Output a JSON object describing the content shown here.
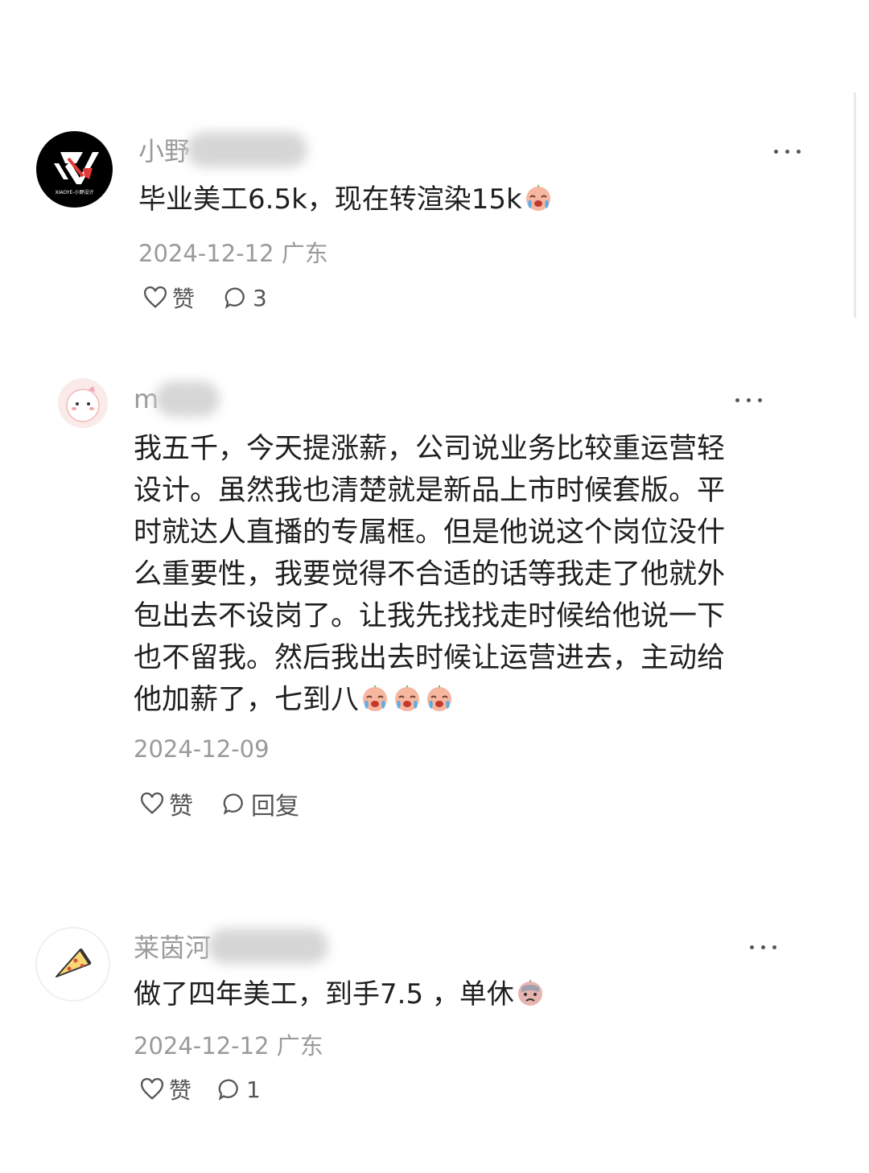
{
  "comments": [
    {
      "username": "小野",
      "text": "毕业美工6.5k，现在转渲染15k",
      "emoji": "crying-face-emoji",
      "date": "2024-12-12 广东",
      "like_label": "赞",
      "reply_count": "3"
    },
    {
      "username": "m",
      "text_lines": [
        "我五千，今天提涨薪，公司说业务比较重运营轻",
        "设计。虽然我也清楚就是新品上市时候套版。平",
        "时就达人直播的专属框。但是他说这个岗位没什",
        "么重要性，我要觉得不合适的话等我走了他就外",
        "包出去不设岗了。让我先找找走时候给他说一下",
        "也不留我。然后我出去时候让运营进去，主动给",
        "他加薪了，七到八"
      ],
      "emoji": "crying-face-emoji",
      "date": "2024-12-09",
      "like_label": "赞",
      "reply_label": "回复"
    },
    {
      "username": "莱茵河",
      "text": "做了四年美工，到手7.5 ，单休",
      "emoji": "sad-face-emoji",
      "date": "2024-12-12 广东",
      "like_label": "赞",
      "reply_count": "1"
    }
  ],
  "avatar_logo_text": "XIAOYE-小野设计"
}
